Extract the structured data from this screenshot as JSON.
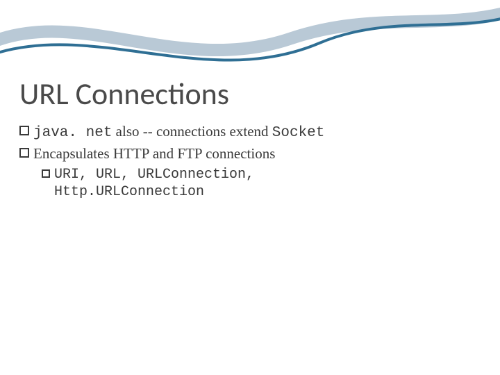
{
  "title": "URL Connections",
  "bullets": [
    {
      "pre_code": "java. net",
      "mid_text": " also -- connections extend ",
      "post_code": "Socket"
    },
    {
      "text": "Encapsulates HTTP and FTP connections"
    }
  ],
  "subbullets": [
    {
      "code_line1": "URI, URL, URLConnection,",
      "code_line2": "Http.URLConnection"
    }
  ],
  "decor": {
    "stroke1": "#b9c9d6",
    "stroke2": "#2f6f94"
  }
}
